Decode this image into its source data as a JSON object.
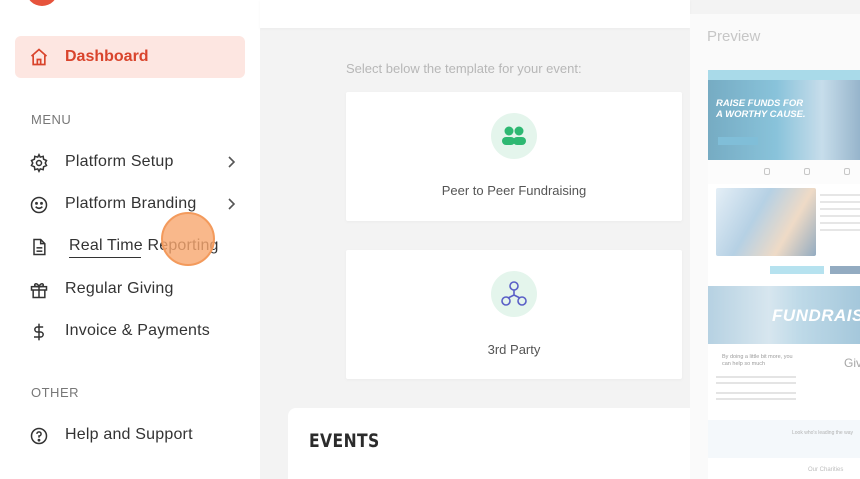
{
  "sidebar": {
    "active_item": {
      "label": "Dashboard",
      "icon": "home-icon"
    },
    "menu_heading": "MENU",
    "menu_items": [
      {
        "label": "Platform Setup",
        "icon": "gear-icon",
        "has_submenu": true
      },
      {
        "label": "Platform Branding",
        "icon": "smiley-icon",
        "has_submenu": true
      },
      {
        "label": "Real Time Reporting",
        "icon": "document-icon",
        "has_submenu": false
      },
      {
        "label": "Regular Giving",
        "icon": "gift-icon",
        "has_submenu": false
      },
      {
        "label": "Invoice & Payments",
        "icon": "dollar-icon",
        "has_submenu": false
      }
    ],
    "other_heading": "OTHER",
    "other_items": [
      {
        "label": "Help and Support",
        "icon": "help-circle-icon"
      }
    ]
  },
  "main": {
    "select_hint": "Select below the template for your event:",
    "templates": [
      {
        "label": "Peer to Peer Fundraising",
        "icon": "people-icon"
      },
      {
        "label": "3rd Party",
        "icon": "network-icon"
      }
    ],
    "events_title": "EVENTS"
  },
  "preview": {
    "title": "Preview",
    "hero_text": "RAISE FUNDS FOR A WORTHY CAUSE.",
    "band_text": "FUNDRAIS",
    "body_text": "By doing a little bit more, you can help so much",
    "give_text": "Giv",
    "bottom_text": "Look who's leading the way",
    "footer_text": "Our Charities"
  },
  "colors": {
    "accent": "#d9442c",
    "accent_bg": "#fde6e1",
    "badge_bg": "#e4f5ec",
    "people_icon": "#2eb872",
    "network_icon": "#5a5fc7",
    "cursor": "#f7a66e"
  }
}
